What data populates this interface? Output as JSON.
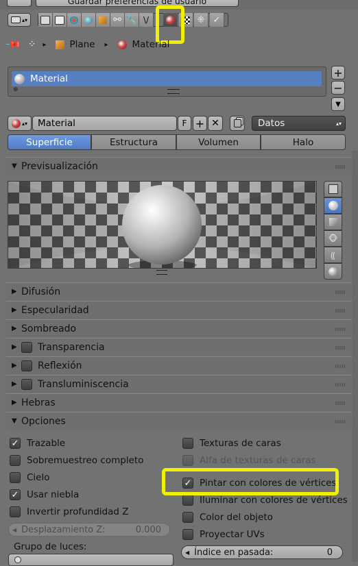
{
  "topbar": {
    "save_prefs_label": "Guardar preferencias de usuario"
  },
  "properties_tabs": [
    "render-icon",
    "render-layers-icon",
    "scene-icon",
    "world-icon",
    "object-icon",
    "constraints-icon",
    "modifiers-icon",
    "data-icon",
    "material-icon",
    "texture-icon",
    "particles-icon",
    "physics-icon"
  ],
  "breadcrumb": {
    "object": "Plane",
    "material": "Material"
  },
  "slots": {
    "items": [
      "Material"
    ]
  },
  "material_field": {
    "name": "Material",
    "fake_user": "F",
    "link_mode": "Datos"
  },
  "tabs": [
    "Superficie",
    "Estructura",
    "Volumen",
    "Halo"
  ],
  "active_tab": "Superficie",
  "preview": {
    "title": "Previsualización"
  },
  "panels": {
    "difusion": "Difusión",
    "especularidad": "Especularidad",
    "sombreado": "Sombreado",
    "transparencia": "Transparencia",
    "reflexion": "Reflexión",
    "transluminiscencia": "Transluminiscencia",
    "hebras": "Hebras",
    "opciones": "Opciones"
  },
  "options": {
    "left": [
      {
        "label": "Trazable",
        "checked": true
      },
      {
        "label": "Sobremuestreo completo",
        "checked": false
      },
      {
        "label": "Cielo",
        "checked": false
      },
      {
        "label": "Usar niebla",
        "checked": true
      },
      {
        "label": "Invertir profundidad Z",
        "checked": false
      }
    ],
    "right": [
      {
        "label": "Texturas de caras",
        "checked": false
      },
      {
        "label": "Alfa de texturas de caras",
        "checked": false
      },
      {
        "label": "Pintar con colores de vértices",
        "checked": true
      },
      {
        "label": "Iluminar con colores de vértices",
        "checked": false
      },
      {
        "label": "Color del objeto",
        "checked": false
      },
      {
        "label": "Proyectar UVs",
        "checked": false
      }
    ],
    "z_offset": {
      "label": "Desplazamiento Z:",
      "value": "0.000"
    },
    "light_group": {
      "label": "Grupo de luces:"
    },
    "pass_index": {
      "label": "Índice en pasada:",
      "value": "0"
    }
  }
}
